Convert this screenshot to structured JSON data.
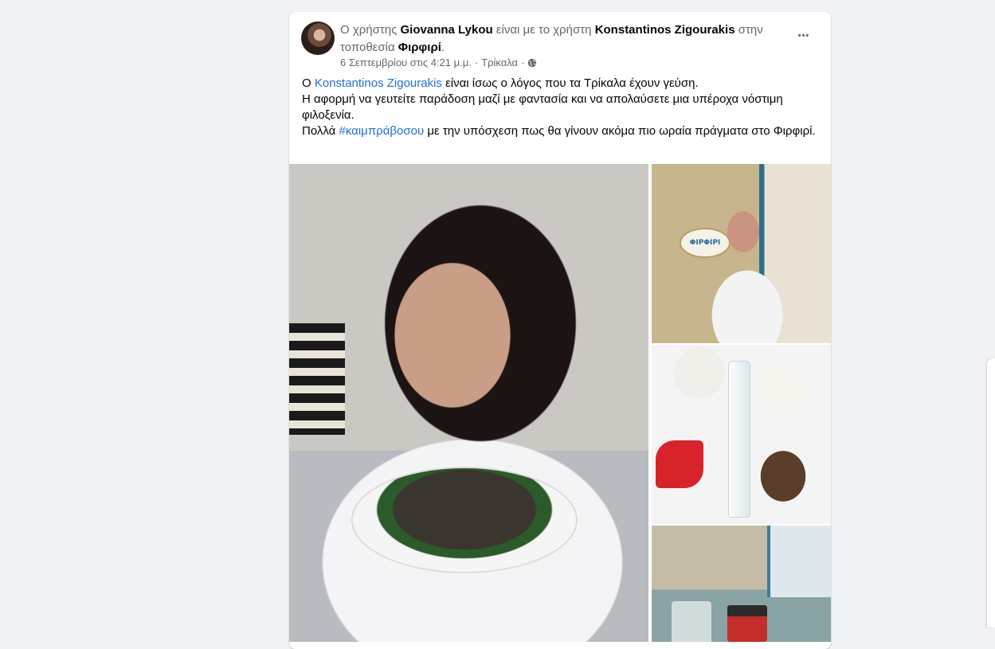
{
  "post": {
    "author": "Giovanna Lykou",
    "header_prefix": "Ο χρήστης ",
    "header_with": " είναι με το χρήστη ",
    "tagged": "Konstantinos Zigourakis",
    "header_at": " στην τοποθεσία ",
    "place": "Φιρφιρί",
    "header_end": ".",
    "timestamp": "6 Σεπτεμβρίου στις 4:21 μ.μ.",
    "separator": "·",
    "location": "Τρίκαλα",
    "more_label": "•••",
    "text": {
      "line1_prefix": "Ο ",
      "line1_link": "Konstantinos Zigourakis",
      "line1_suffix": " είναι ίσως ο λόγος που τα Τρίκαλα έχουν γεύση.",
      "line2": "Η αφορμή να γευτείτε παράδοση μαζί με φαντασία και να απολαύσετε μια υπέροχα νόστιμη φιλοξενία.",
      "line3_prefix": "Πολλά ",
      "line3_hashtag": "#καιμπράβοσου",
      "line3_suffix": " με την υπόσχεση πως  θα γίνουν ακόμα πιο ωραία πράγματα στο Φιρφιρί."
    },
    "sign_text": "ΦΙΡΦΙΡΙ"
  },
  "colors": {
    "link": "#216fdb",
    "secondary_text": "#65676b",
    "background": "#f0f2f5"
  }
}
